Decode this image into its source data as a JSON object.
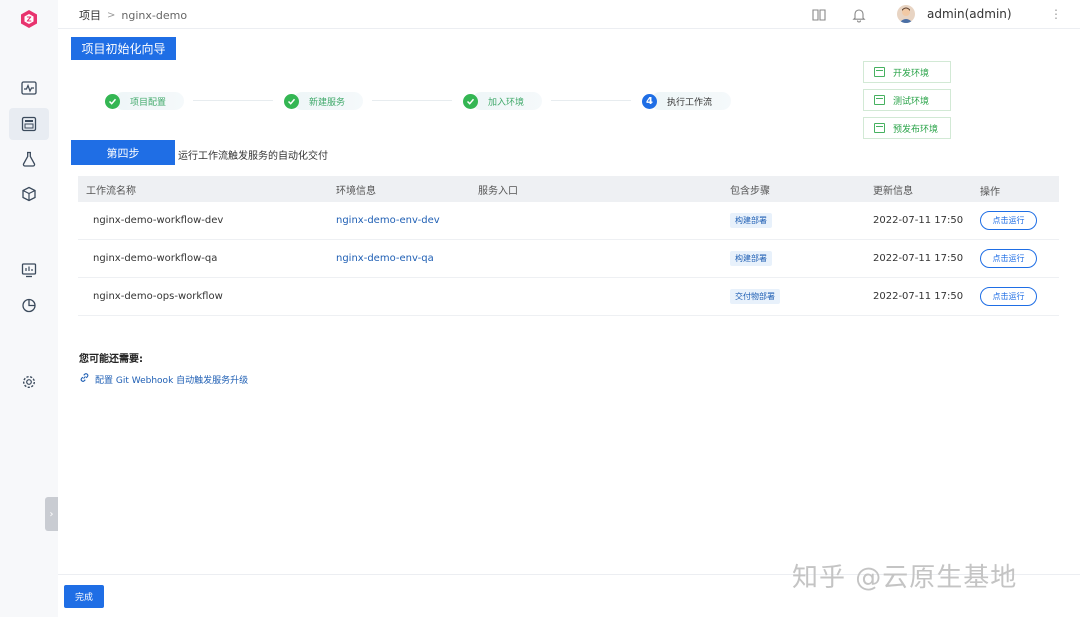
{
  "header": {
    "breadcrumb_root": "项目",
    "breadcrumb_sep": ">",
    "breadcrumb_current": "nginx-demo",
    "username": "admin(admin)"
  },
  "guide": {
    "title": "项目初始化向导",
    "steps": [
      {
        "label": "项目配置",
        "status": "done"
      },
      {
        "label": "新建服务",
        "status": "done"
      },
      {
        "label": "加入环境",
        "status": "done"
      },
      {
        "label": "执行工作流",
        "status": "current",
        "number": "4"
      }
    ],
    "envs": [
      "开发环境",
      "测试环境",
      "预发布环境"
    ],
    "step_tag": "第四步",
    "step_desc": "运行工作流触发服务的自动化交付"
  },
  "table": {
    "headers": [
      "工作流名称",
      "环境信息",
      "服务入口",
      "包含步骤",
      "更新信息",
      "操作"
    ],
    "rows": [
      {
        "name": "nginx-demo-workflow-dev",
        "env": "nginx-demo-env-dev",
        "entry": "",
        "steps": "构建部署",
        "updated": "2022-07-11 17:50",
        "action": "点击运行"
      },
      {
        "name": "nginx-demo-workflow-qa",
        "env": "nginx-demo-env-qa",
        "entry": "",
        "steps": "构建部署",
        "updated": "2022-07-11 17:50",
        "action": "点击运行"
      },
      {
        "name": "nginx-demo-ops-workflow",
        "env": "",
        "entry": "",
        "steps": "交付物部署",
        "updated": "2022-07-11 17:50",
        "action": "点击运行"
      }
    ]
  },
  "suggest": {
    "title": "您可能还需要:",
    "link": "配置 Git Webhook 自动触发服务升级"
  },
  "footer": {
    "done_label": "完成",
    "watermark": "知乎 @云原生基地"
  },
  "colors": {
    "primary": "#1f6ee5",
    "success": "#34b653",
    "link": "#1f5fb4"
  }
}
